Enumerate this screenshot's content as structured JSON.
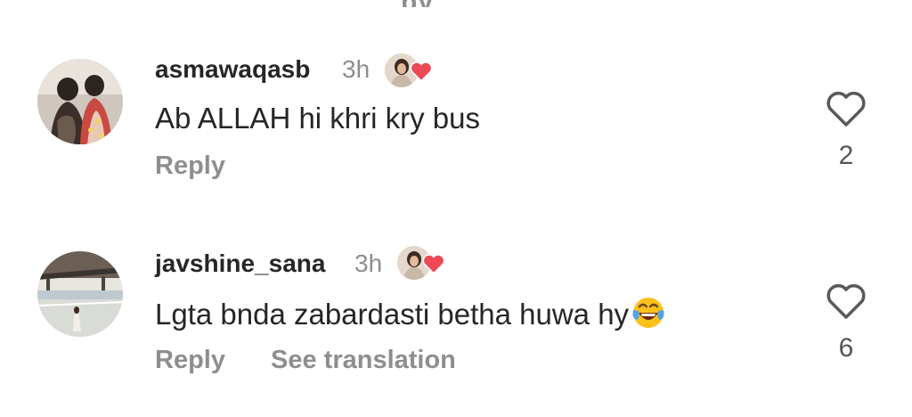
{
  "top_fragment": "py",
  "comments": [
    {
      "username": "asmawaqasb",
      "time": "3h",
      "text": "Ab ALLAH hi khri kry bus",
      "actions": {
        "reply": "Reply"
      },
      "like_count": "2",
      "liked_by_author": true
    },
    {
      "username": "javshine_sana",
      "time": "3h",
      "text": "Lgta bnda zabardasti betha huwa hy",
      "emoji": "face-with-tears-of-joy",
      "actions": {
        "reply": "Reply",
        "see_translation": "See translation"
      },
      "like_count": "6",
      "liked_by_author": true
    }
  ],
  "colors": {
    "text": "#262626",
    "secondary": "#8e8e8e",
    "heart": "#ed4956"
  }
}
